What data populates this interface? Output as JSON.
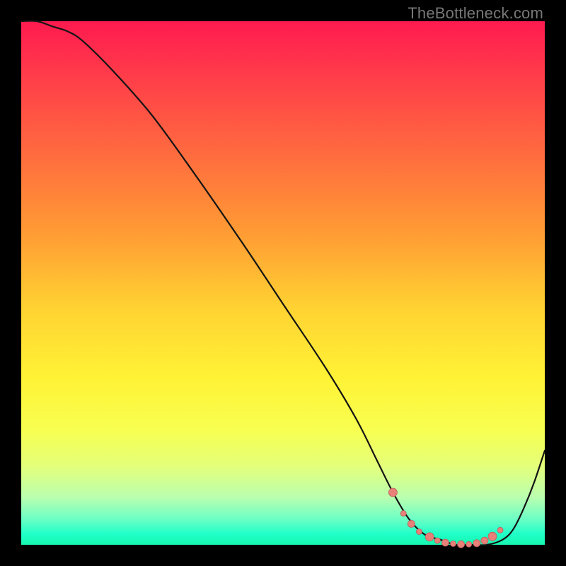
{
  "watermark": "TheBottleneck.com",
  "colors": {
    "frame": "#000000",
    "curve": "#141414",
    "dot_fill": "#e97f79",
    "dot_stroke": "#b75e58"
  },
  "chart_data": {
    "type": "line",
    "title": "",
    "xlabel": "",
    "ylabel": "",
    "xlim": [
      0,
      100
    ],
    "ylim": [
      0,
      100
    ],
    "grid": false,
    "legend": false,
    "note": "Values estimated from unlabeled axes; y=0 is the floor (green band), y=100 is the top (red).",
    "series": [
      {
        "name": "bottleneck-curve",
        "x": [
          0,
          3,
          6,
          9,
          12,
          18,
          25,
          33,
          42,
          50,
          58,
          64,
          68,
          71,
          74,
          77,
          80,
          83,
          86,
          89,
          92,
          94,
          96,
          98,
          100
        ],
        "y": [
          100,
          100,
          99,
          98,
          96,
          90,
          82,
          71,
          58,
          46,
          34,
          24,
          16,
          10,
          5,
          2,
          1,
          0,
          0,
          0,
          1,
          3,
          7,
          12,
          18
        ]
      }
    ],
    "dots": {
      "name": "highlighted-range",
      "x": [
        71.0,
        73.0,
        74.5,
        76.0,
        78.0,
        79.5,
        81.0,
        82.5,
        84.0,
        85.5,
        87.0,
        88.5,
        90.0,
        91.5
      ],
      "y": [
        10.0,
        6.0,
        4.0,
        2.5,
        1.5,
        0.8,
        0.4,
        0.2,
        0.1,
        0.1,
        0.3,
        0.8,
        1.6,
        2.8
      ],
      "r": [
        6,
        4,
        5,
        4,
        6,
        4,
        5,
        4,
        5,
        4,
        5,
        5,
        6,
        4
      ]
    }
  }
}
